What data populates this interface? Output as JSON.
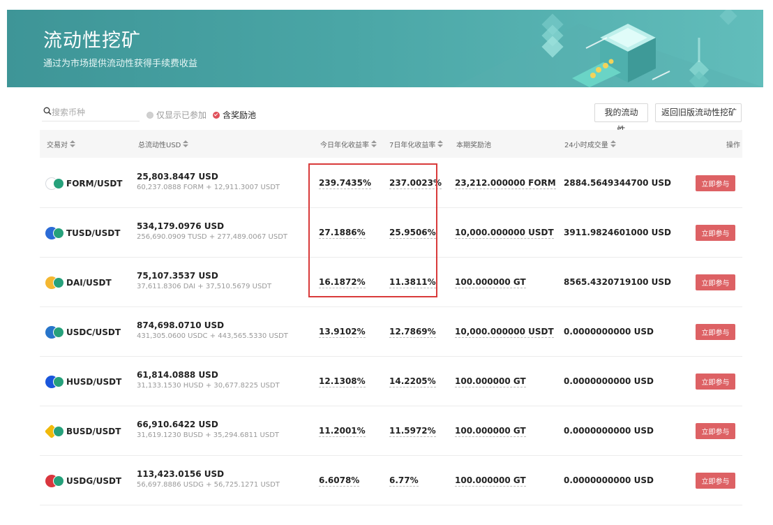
{
  "banner": {
    "title": "流动性挖矿",
    "subtitle": "通过为市场提供流动性获得手续费收益"
  },
  "toolbar": {
    "search_placeholder": "搜索币种",
    "filter_joined_label": "仅显示已参加",
    "filter_reward_label": "含奖励池",
    "my_liquidity_label": "我的流动性",
    "old_version_label": "返回旧版流动性挖矿"
  },
  "table": {
    "headers": {
      "pair": "交易对",
      "total_liquidity": "总流动性USD",
      "today_apy": "今日年化收益率",
      "week_apy": "7日年化收益率",
      "reward_pool": "本期奖励池",
      "volume_24h": "24小时成交量",
      "action": "操作"
    },
    "join_label": "立即参与",
    "rows": [
      {
        "pair": "FORM/USDT",
        "icon": "form-coin-icon",
        "icon_color": "#6e7a8a",
        "liquidity": "25,803.8447 USD",
        "liquidity_detail": "60,237.0888 FORM + 12,911.3007 USDT",
        "today_apy": "239.7435%",
        "week_apy": "237.0023%",
        "reward_pool": "23,212.000000 FORM",
        "volume_24h": "2884.5649344700 USD"
      },
      {
        "pair": "TUSD/USDT",
        "icon": "tusd-coin-icon",
        "icon_color": "#2b6bd6",
        "liquidity": "534,179.0976 USD",
        "liquidity_detail": "256,690.0909 TUSD + 277,489.0067 USDT",
        "today_apy": "27.1886%",
        "week_apy": "25.9506%",
        "reward_pool": "10,000.000000 USDT",
        "volume_24h": "3911.9824601000 USD"
      },
      {
        "pair": "DAI/USDT",
        "icon": "dai-coin-icon",
        "icon_color": "#f4b731",
        "liquidity": "75,107.3537 USD",
        "liquidity_detail": "37,611.8306 DAI + 37,510.5679 USDT",
        "today_apy": "16.1872%",
        "week_apy": "11.3811%",
        "reward_pool": "100.000000 GT",
        "volume_24h": "8565.4320719100 USD"
      },
      {
        "pair": "USDC/USDT",
        "icon": "usdc-coin-icon",
        "icon_color": "#2775ca",
        "liquidity": "874,698.0710 USD",
        "liquidity_detail": "431,305.0600 USDC + 443,565.5330 USDT",
        "today_apy": "13.9102%",
        "week_apy": "12.7869%",
        "reward_pool": "10,000.000000 USDT",
        "volume_24h": "0.0000000000 USD"
      },
      {
        "pair": "HUSD/USDT",
        "icon": "husd-coin-icon",
        "icon_color": "#1a56db",
        "liquidity": "61,814.0888 USD",
        "liquidity_detail": "31,133.1530 HUSD + 30,677.8225 USDT",
        "today_apy": "12.1308%",
        "week_apy": "14.2205%",
        "reward_pool": "100.000000 GT",
        "volume_24h": "0.0000000000 USD"
      },
      {
        "pair": "BUSD/USDT",
        "icon": "busd-coin-icon",
        "icon_color": "#f0b90b",
        "liquidity": "66,910.6422 USD",
        "liquidity_detail": "31,619.1230 BUSD + 35,294.6811 USDT",
        "today_apy": "11.2001%",
        "week_apy": "11.5972%",
        "reward_pool": "100.000000 GT",
        "volume_24h": "0.0000000000 USD"
      },
      {
        "pair": "USDG/USDT",
        "icon": "usdg-coin-icon",
        "icon_color": "#d9363e",
        "liquidity": "113,423.0156 USD",
        "liquidity_detail": "56,697.8886 USDG + 56,725.1271 USDT",
        "today_apy": "6.6078%",
        "week_apy": "6.77%",
        "reward_pool": "100.000000 GT",
        "volume_24h": "0.0000000000 USD"
      }
    ]
  }
}
